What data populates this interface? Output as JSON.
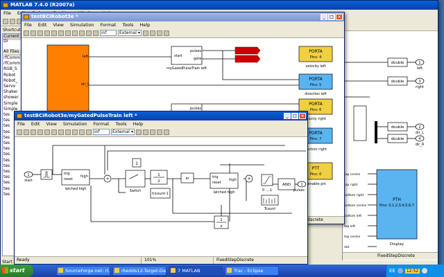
{
  "matlab": {
    "title": "MATLAB 7.4.0 (R2007a)",
    "menu": [
      "File",
      "Edit",
      "Debug",
      "Desktop",
      "Window",
      "Help"
    ],
    "shortcuts": "Shortcuts",
    "current_dir": "Current Di",
    "all_files": "All Files",
    "files": [
      "rfComm",
      "rfComm",
      "RGB_S",
      "Robot",
      "Robot_",
      "Servo",
      "Shaker",
      "shower",
      "Simple",
      "Simple",
      "tes",
      "tes",
      "tes",
      "tes",
      "tes",
      "tes",
      "tes",
      "tes",
      "tes",
      "tes",
      "tes",
      "tes",
      "tes",
      "tes",
      "tes"
    ],
    "status_start": "Start"
  },
  "back_window": {
    "title": "testBCIRobot3e *",
    "menu": [
      "File",
      "Edit",
      "View",
      "Simulation",
      "Format",
      "Tools",
      "Help"
    ],
    "time_value": "inf",
    "mode": "External",
    "status_solver": "Discrete",
    "blocks": {
      "pulses": "pulses",
      "gate": "gate",
      "start": "start",
      "pulses2": "pulses",
      "pulse_train_left": "myGatedPulseTrain left",
      "port_left_label": "left",
      "port_dir_label": "dir_L",
      "porta1": "PORTA",
      "porta1_pins": "Pins: 4",
      "porta1_caption": "velocity left",
      "porta2": "PORTA",
      "porta2_pins": "Pins: 5",
      "porta2_caption": "direction left",
      "porta3": "PORTA",
      "porta3_pins": "Pins: 6",
      "porta3_caption": "elocity right",
      "porta4": "PORTA",
      "porta4_pins": "Pins: 7",
      "porta4_caption": "irection right",
      "ptt": "PTT",
      "ptt_pins": "Pins: 0",
      "ptt_caption": "r enable pin"
    }
  },
  "right_window": {
    "double": "double",
    "out1": "1",
    "out1_label": "left",
    "out2": "3",
    "out2_label": "right",
    "out3": "2",
    "out3_label": "dir_L",
    "out4": "4",
    "out4_label": "dir_R",
    "pth": "PTH",
    "pth_pins": "Pins: 0,1,2,3,4,5,6,7",
    "pth_caption": "Display",
    "inputs": [
      "top centre",
      "top right",
      "bottom right",
      "bottom centre",
      "bottom left",
      "top left",
      "top centre",
      "dot"
    ],
    "status_solver": "FixedStepDiscrete"
  },
  "front_window": {
    "title": "testBCIRobot3e/myGatedPulseTrain left *",
    "menu": [
      "File",
      "Edit",
      "View",
      "Simulation",
      "Format",
      "Tools",
      "Help"
    ],
    "time_value": "inf",
    "mode": "External",
    "status_ready": "Ready",
    "status_zoom": "101%",
    "status_solver": "FixedStepDiscrete",
    "blocks": {
      "in1": "1",
      "start_label": "start",
      "trig": "trig",
      "reset": "reset",
      "high": "high",
      "latched1": "latched high",
      "const1": "1",
      "switch_label": "Switch",
      "gain": "1",
      "ratio_num": "1",
      "ratio_den": "2",
      "hicount": "hicount-1",
      "xor_label": "ar",
      "trig2": "trig",
      "reset2": "reset",
      "high2": "high",
      "latched2": "latched high",
      "sat_label": "0 ... 1",
      "and_label": "AND",
      "out1": "1",
      "out1_label": "pulses",
      "tcount": "Tcount",
      "delay_num": "1",
      "delay_den": "z"
    }
  },
  "taskbar": {
    "start": "start",
    "buttons": [
      "SourceForge.net: rt...",
      "rbedds12-Target-Da...",
      "7 MATLAB",
      "Trac - Eclipse"
    ],
    "tray": [
      "EE"
    ],
    "time": "12:52"
  }
}
